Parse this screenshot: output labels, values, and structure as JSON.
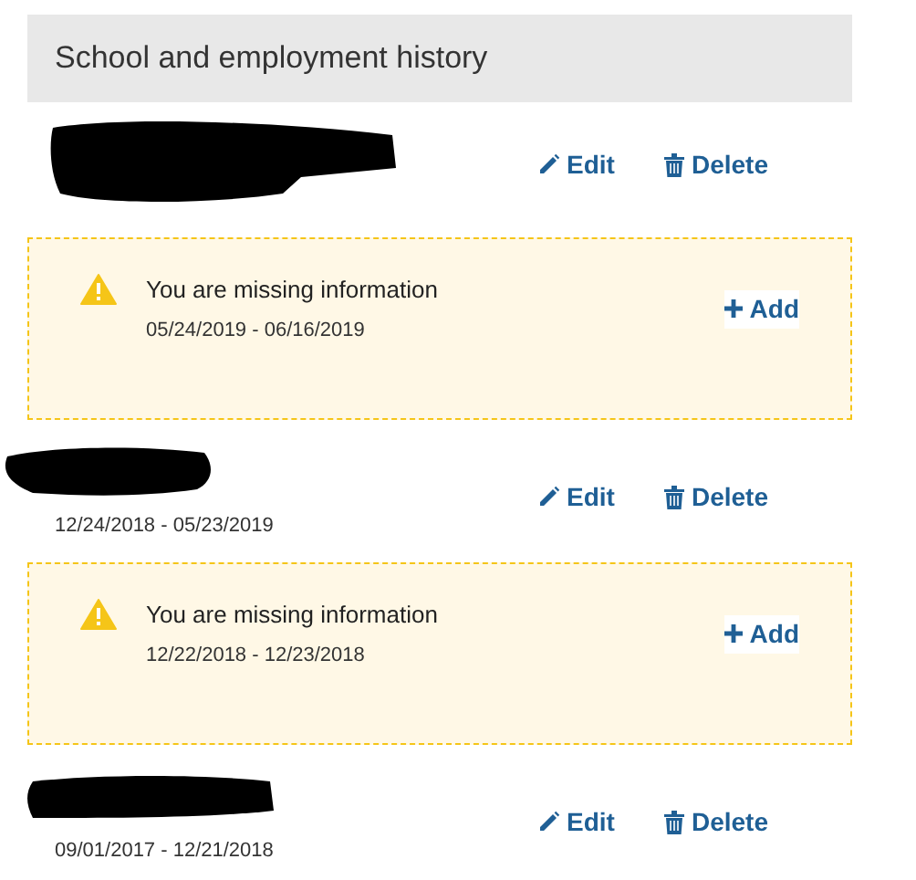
{
  "header": {
    "title": "School and employment history"
  },
  "items": [
    {
      "kind": "entry",
      "redacted": true,
      "actions": [
        {
          "kind": "edit",
          "label": "Edit"
        },
        {
          "kind": "delete",
          "label": "Delete"
        }
      ]
    },
    {
      "kind": "gap",
      "message": "You are missing information",
      "dates": "05/24/2019 - 06/16/2019",
      "action": {
        "kind": "add",
        "label": "Add"
      }
    },
    {
      "kind": "entry",
      "redacted": true,
      "dates": "12/24/2018 - 05/23/2019",
      "actions": [
        {
          "kind": "edit",
          "label": "Edit"
        },
        {
          "kind": "delete",
          "label": "Delete"
        }
      ]
    },
    {
      "kind": "gap",
      "message": "You are missing information",
      "dates": "12/22/2018 - 12/23/2018",
      "action": {
        "kind": "add",
        "label": "Add"
      }
    },
    {
      "kind": "entry",
      "redacted": true,
      "dates": "09/01/2017 - 12/21/2018",
      "actions": [
        {
          "kind": "edit",
          "label": "Edit"
        },
        {
          "kind": "delete",
          "label": "Delete"
        }
      ]
    }
  ]
}
